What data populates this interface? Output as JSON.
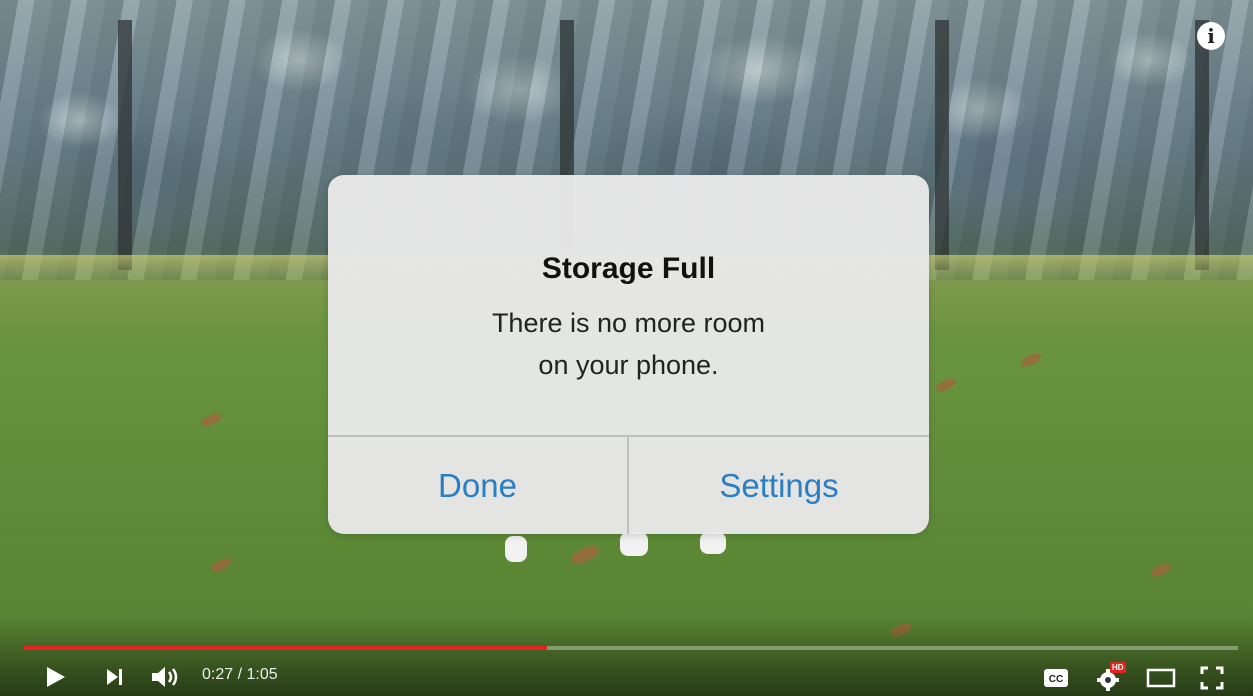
{
  "dialog": {
    "title": "Storage Full",
    "message": "There is no more room\non your phone.",
    "buttons": {
      "done": "Done",
      "settings": "Settings"
    },
    "button_color": "#2a7ec4"
  },
  "player": {
    "info_icon": "info-icon",
    "time_current": "0:27",
    "time_separator": " / ",
    "time_total": "1:05",
    "progress_fraction": 0.431,
    "progress_color": "#e52420",
    "icons": {
      "play": "play-icon",
      "next": "next-icon",
      "volume": "volume-icon",
      "captions": "captions-icon",
      "settings": "settings-gear-icon",
      "hd_badge": "HD",
      "theater": "theater-mode-icon",
      "fullscreen": "fullscreen-icon"
    }
  }
}
